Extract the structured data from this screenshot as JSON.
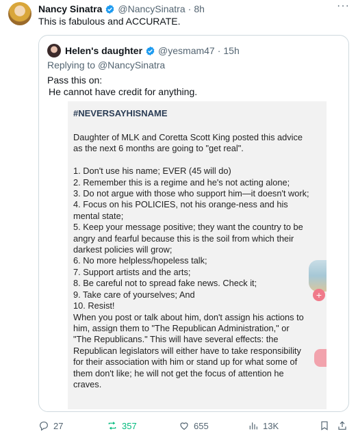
{
  "tweet": {
    "name": "Nancy Sinatra",
    "handle": "@NancySinatra",
    "separator": "·",
    "time": "8h",
    "text": "This is fabulous and ACCURATE."
  },
  "quote": {
    "name": "Helen's daughter",
    "handle": "@yesmam47",
    "separator": "·",
    "time": "15h",
    "reply_prefix": "Replying to",
    "reply_to": "@NancySinatra",
    "text_line1": "Pass this on:",
    "text_line2": "He cannot have credit for anything.",
    "image": {
      "hashtag": "#NEVERSAYHISNAME",
      "lines": [
        "Daughter of MLK and Coretta Scott King posted this advice",
        "as the next 6 months are going to \"get real\".",
        "",
        "1. Don't use his name; EVER (45 will do)",
        "2. Remember this is a regime and he's not acting alone;",
        "3. Do not argue with those who support him—it doesn't work;",
        "4. Focus on his POLICIES, not his orange-ness and his",
        "mental state;",
        "5. Keep your message positive; they want the country to be",
        "angry and fearful because this is the soil from which their",
        "darkest policies will grow;",
        "6. No more helpless/hopeless talk;",
        "7. Support artists and the arts;",
        "8. Be careful not to spread fake news. Check it;",
        "9. Take care of yourselves; And",
        "10. Resist!",
        "When you post or talk about him, don't assign his actions to",
        "him, assign them to \"The Republican Administration,\" or",
        "\"The Republicans.\" This will have several effects: the",
        "Republican legislators will either have to take responsibility",
        "for their association with him or stand up for what some of",
        "them don't like; he will not get the focus of attention he",
        "craves."
      ]
    }
  },
  "actions": {
    "replies": "27",
    "reposts": "357",
    "likes": "655",
    "views": "13K"
  },
  "icons": {
    "verified": "verified-badge-icon",
    "more": "more-icon",
    "reply": "reply-icon",
    "repost": "repost-icon",
    "like": "heart-icon",
    "views": "views-icon",
    "bookmark": "bookmark-icon",
    "share": "share-icon"
  },
  "colors": {
    "verified": "#1d9bf0",
    "repost_active": "#00ba7c",
    "secondary_text": "#536471"
  }
}
